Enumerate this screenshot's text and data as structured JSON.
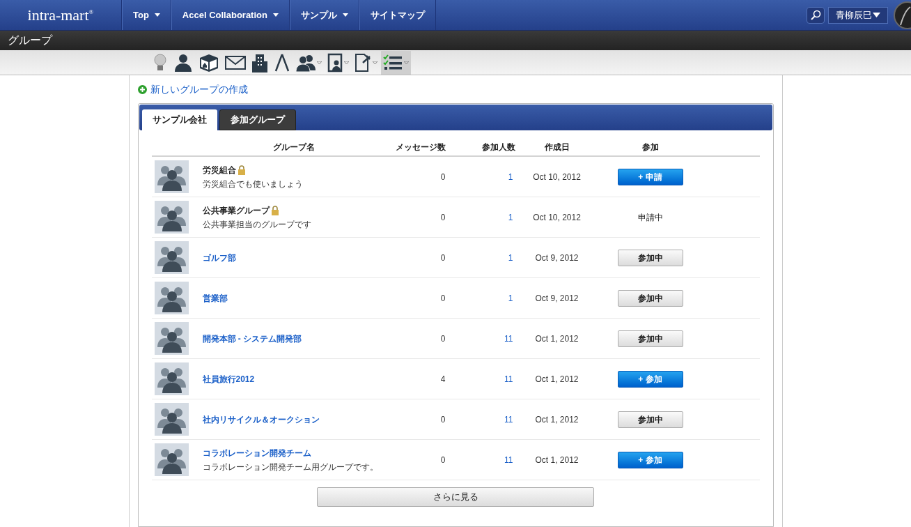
{
  "header": {
    "logo": "intra-mart",
    "logo_mark": "®",
    "nav": [
      {
        "label": "Top",
        "dropdown": true
      },
      {
        "label": "Accel Collaboration",
        "dropdown": true
      },
      {
        "label": "サンプル",
        "dropdown": true
      },
      {
        "label": "サイトマップ",
        "dropdown": false
      }
    ],
    "user": "青柳辰巳"
  },
  "page_title": "グループ",
  "toolbar": [
    {
      "kind": "bulb",
      "dropdown": false,
      "selected": false
    },
    {
      "kind": "person",
      "dropdown": false,
      "selected": false
    },
    {
      "kind": "box",
      "dropdown": false,
      "selected": false
    },
    {
      "kind": "mail",
      "dropdown": false,
      "selected": false
    },
    {
      "kind": "building",
      "dropdown": false,
      "selected": false
    },
    {
      "kind": "compass",
      "dropdown": false,
      "selected": false
    },
    {
      "kind": "people",
      "dropdown": true,
      "selected": false
    },
    {
      "kind": "clipboard",
      "dropdown": true,
      "selected": false
    },
    {
      "kind": "document",
      "dropdown": true,
      "selected": false
    },
    {
      "kind": "checklist",
      "dropdown": true,
      "selected": true
    }
  ],
  "create_link": "新しいグループの作成",
  "tabs": [
    {
      "label": "サンプル会社",
      "selected": true
    },
    {
      "label": "参加グループ",
      "selected": false
    }
  ],
  "table": {
    "columns": [
      "グループ名",
      "メッセージ数",
      "参加人数",
      "作成日",
      "参加"
    ],
    "rows": [
      {
        "name": "労災組合",
        "locked": true,
        "link": false,
        "description": "労災組合でも使いましょう",
        "messages": "0",
        "members": "1",
        "created": "Oct 10, 2012",
        "join": {
          "kind": "primary",
          "label": "+ 申請"
        }
      },
      {
        "name": "公共事業グループ",
        "locked": true,
        "link": false,
        "description": "公共事業担当のグループです",
        "messages": "0",
        "members": "1",
        "created": "Oct 10, 2012",
        "join": {
          "kind": "text",
          "label": "申請中"
        }
      },
      {
        "name": "ゴルフ部",
        "locked": false,
        "link": true,
        "messages": "0",
        "members": "1",
        "created": "Oct 9, 2012",
        "join": {
          "kind": "secondary",
          "label": "参加中"
        }
      },
      {
        "name": "営業部",
        "locked": false,
        "link": true,
        "messages": "0",
        "members": "1",
        "created": "Oct 9, 2012",
        "join": {
          "kind": "secondary",
          "label": "参加中"
        }
      },
      {
        "name": "開発本部 - システム開発部",
        "locked": false,
        "link": true,
        "messages": "0",
        "members": "11",
        "created": "Oct 1, 2012",
        "join": {
          "kind": "secondary",
          "label": "参加中"
        }
      },
      {
        "name": "社員旅行2012",
        "locked": false,
        "link": true,
        "messages": "4",
        "members": "11",
        "created": "Oct 1, 2012",
        "join": {
          "kind": "primary",
          "label": "+ 参加"
        }
      },
      {
        "name": "社内リサイクル＆オークション",
        "locked": false,
        "link": true,
        "messages": "0",
        "members": "11",
        "created": "Oct 1, 2012",
        "join": {
          "kind": "secondary",
          "label": "参加中"
        }
      },
      {
        "name": "コラボレーション開発チーム",
        "locked": false,
        "link": true,
        "description": "コラボレーション開発チーム用グループです。",
        "messages": "0",
        "members": "11",
        "created": "Oct 1, 2012",
        "join": {
          "kind": "primary",
          "label": "+ 参加"
        }
      }
    ]
  },
  "more_button": "さらに見る"
}
